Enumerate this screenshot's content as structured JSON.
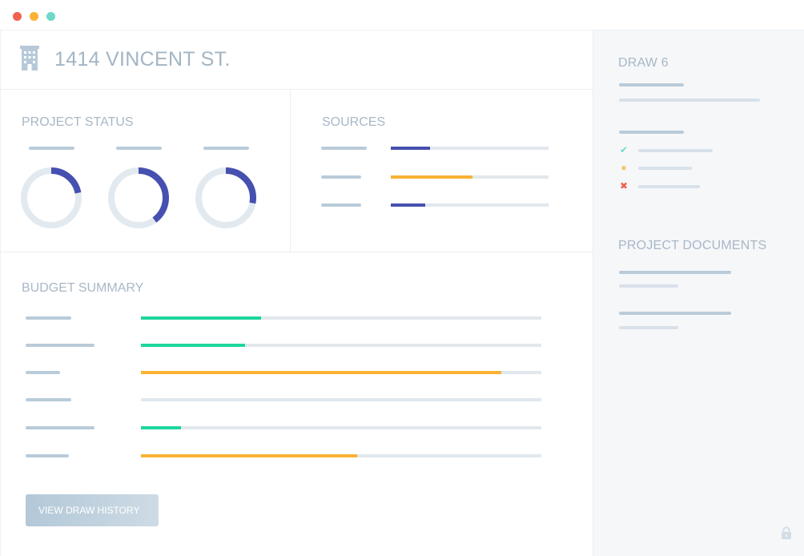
{
  "window": {
    "controls": [
      {
        "name": "close",
        "color": "#f0614f"
      },
      {
        "name": "minimize",
        "color": "#f9b234"
      },
      {
        "name": "maximize",
        "color": "#6ed7c8"
      }
    ]
  },
  "header": {
    "icon": "building-icon",
    "address": "1414 VINCENT ST."
  },
  "project_status": {
    "title": "PROJECT STATUS",
    "donuts": [
      {
        "fraction": 0.22,
        "color": "#4650b0"
      },
      {
        "fraction": 0.4,
        "color": "#4650b0"
      },
      {
        "fraction": 0.28,
        "color": "#4650b0"
      }
    ]
  },
  "sources": {
    "title": "SOURCES",
    "bars": [
      {
        "fraction": 0.25,
        "color": "#4650b0"
      },
      {
        "fraction": 0.52,
        "color": "#f9b234"
      },
      {
        "fraction": 0.22,
        "color": "#4650b0"
      }
    ]
  },
  "budget_summary": {
    "title": "BUDGET SUMMARY",
    "bars": [
      {
        "fraction": 0.3,
        "color": "#1dd69e"
      },
      {
        "fraction": 0.26,
        "color": "#1dd69e"
      },
      {
        "fraction": 0.9,
        "color": "#f9b234"
      },
      {
        "fraction": 0.0,
        "color": "#1dd69e"
      },
      {
        "fraction": 0.1,
        "color": "#1dd69e"
      },
      {
        "fraction": 0.54,
        "color": "#f9b234"
      }
    ],
    "button_label": "VIEW DRAW HISTORY"
  },
  "sidebar": {
    "draw_title": "DRAW 6",
    "checklist": [
      {
        "status": "complete",
        "icon": "check-icon",
        "color": "#6ed7c8",
        "glyph": "✔"
      },
      {
        "status": "pending",
        "icon": "circle-icon",
        "color": "#f9c46a",
        "glyph": "●"
      },
      {
        "status": "rejected",
        "icon": "x-icon",
        "color": "#f0614f",
        "glyph": "✖"
      }
    ],
    "documents_title": "PROJECT DOCUMENTS",
    "footer_icon": "lock-icon"
  }
}
